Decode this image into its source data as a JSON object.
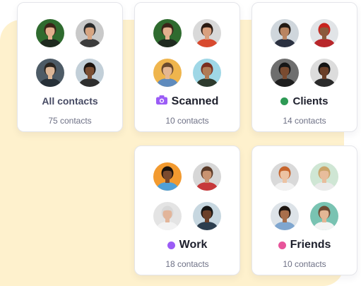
{
  "groups": [
    {
      "id": "all",
      "name": "All contacts",
      "count": "75 contacts",
      "icon": "none",
      "avatars": [
        {
          "label": "woman-green-jacket",
          "bg": "#2f6b2f",
          "skin": "#e2b08e",
          "hair": "#3b2418",
          "shirt": "#1f2a1f"
        },
        {
          "label": "man-cap",
          "bg": "#c9c9c9",
          "skin": "#d7a582",
          "hair": "#2b2b2b",
          "shirt": "#3c3c3c"
        },
        {
          "label": "man-glasses",
          "bg": "#4d5b66",
          "skin": "#dcb697",
          "hair": "#2a2520",
          "shirt": "#273038"
        },
        {
          "label": "man-smiling",
          "bg": "#c2cfd8",
          "skin": "#7b4f33",
          "hair": "#1c140f",
          "shirt": "#2e2e2e"
        }
      ]
    },
    {
      "id": "scanned",
      "name": "Scanned",
      "count": "10 contacts",
      "icon": "camera-icon",
      "color": "#9b5cf6",
      "avatars": [
        {
          "label": "woman-green-jacket",
          "bg": "#2f6b2f",
          "skin": "#e2b08e",
          "hair": "#3b2418",
          "shirt": "#1f2a1f"
        },
        {
          "label": "woman-red-top",
          "bg": "#d9d9d9",
          "skin": "#d9a07e",
          "hair": "#2a1a12",
          "shirt": "#d84a2f"
        },
        {
          "label": "woman-curly-glasses",
          "bg": "#efb54d",
          "skin": "#e5b792",
          "hair": "#6b4a2e",
          "shirt": "#5f8bbd"
        },
        {
          "label": "man-outdoors",
          "bg": "#9fd7e6",
          "skin": "#b07c56",
          "hair": "#7a2e1f",
          "shirt": "#2d3a2d"
        }
      ]
    },
    {
      "id": "clients",
      "name": "Clients",
      "count": "14 contacts",
      "icon": "dot",
      "color": "#2e9a55",
      "avatars": [
        {
          "label": "man-suit-glasses",
          "bg": "#cfd6dc",
          "skin": "#b98461",
          "hair": "#221a14",
          "shirt": "#2b3140"
        },
        {
          "label": "woman-hijab",
          "bg": "#e1e4e7",
          "skin": "#8b5a3c",
          "hair": "#c8241f",
          "shirt": "#b8262a"
        },
        {
          "label": "man-dark-shirt",
          "bg": "#6e6e6e",
          "skin": "#7a4b30",
          "hair": "#161616",
          "shirt": "#1e1e1e"
        },
        {
          "label": "man-suit",
          "bg": "#dcdcdc",
          "skin": "#6a3f28",
          "hair": "#141414",
          "shirt": "#2a2a2a"
        }
      ]
    },
    {
      "id": "work",
      "name": "Work",
      "count": "18 contacts",
      "icon": "dot",
      "color": "#9b5cf6",
      "avatars": [
        {
          "label": "woman-laughing",
          "bg": "#f29a2f",
          "skin": "#7b4a2e",
          "hair": "#1a120c",
          "shirt": "#4fa0d8"
        },
        {
          "label": "man-bald-beard",
          "bg": "#d7d7d7",
          "skin": "#c99371",
          "hair": "#5a3a28",
          "shirt": "#c6383a"
        },
        {
          "label": "older-man-glasses",
          "bg": "#e4e4e4",
          "skin": "#e2b59a",
          "hair": "#d8d8d8",
          "shirt": "#f2f2f2"
        },
        {
          "label": "man-collared-shirt",
          "bg": "#c7d7e0",
          "skin": "#6b4029",
          "hair": "#141414",
          "shirt": "#2c3e4e"
        }
      ]
    },
    {
      "id": "friends",
      "name": "Friends",
      "count": "10 contacts",
      "icon": "dot",
      "color": "#e7549a",
      "avatars": [
        {
          "label": "woman-red-hair",
          "bg": "#d9d9d9",
          "skin": "#ecc3a3",
          "hair": "#c6652d",
          "shirt": "#f1f1f1"
        },
        {
          "label": "woman-blonde-waving",
          "bg": "#cfe6d4",
          "skin": "#e8bd9c",
          "hair": "#c9a46a",
          "shirt": "#eaeaea"
        },
        {
          "label": "man-beard-blue",
          "bg": "#dde3e8",
          "skin": "#a86f4c",
          "hair": "#1d1510",
          "shirt": "#7fa6cf"
        },
        {
          "label": "woman-glasses-teal",
          "bg": "#79c3b2",
          "skin": "#e4b795",
          "hair": "#6d4a33",
          "shirt": "#f3f3f3"
        }
      ]
    }
  ],
  "colors": {
    "backdrop": "#fef1cd",
    "card_border": "#e4e5ea",
    "title_text": "#1d1f2c",
    "muted_title": "#474b64",
    "count_text": "#6d7085"
  }
}
